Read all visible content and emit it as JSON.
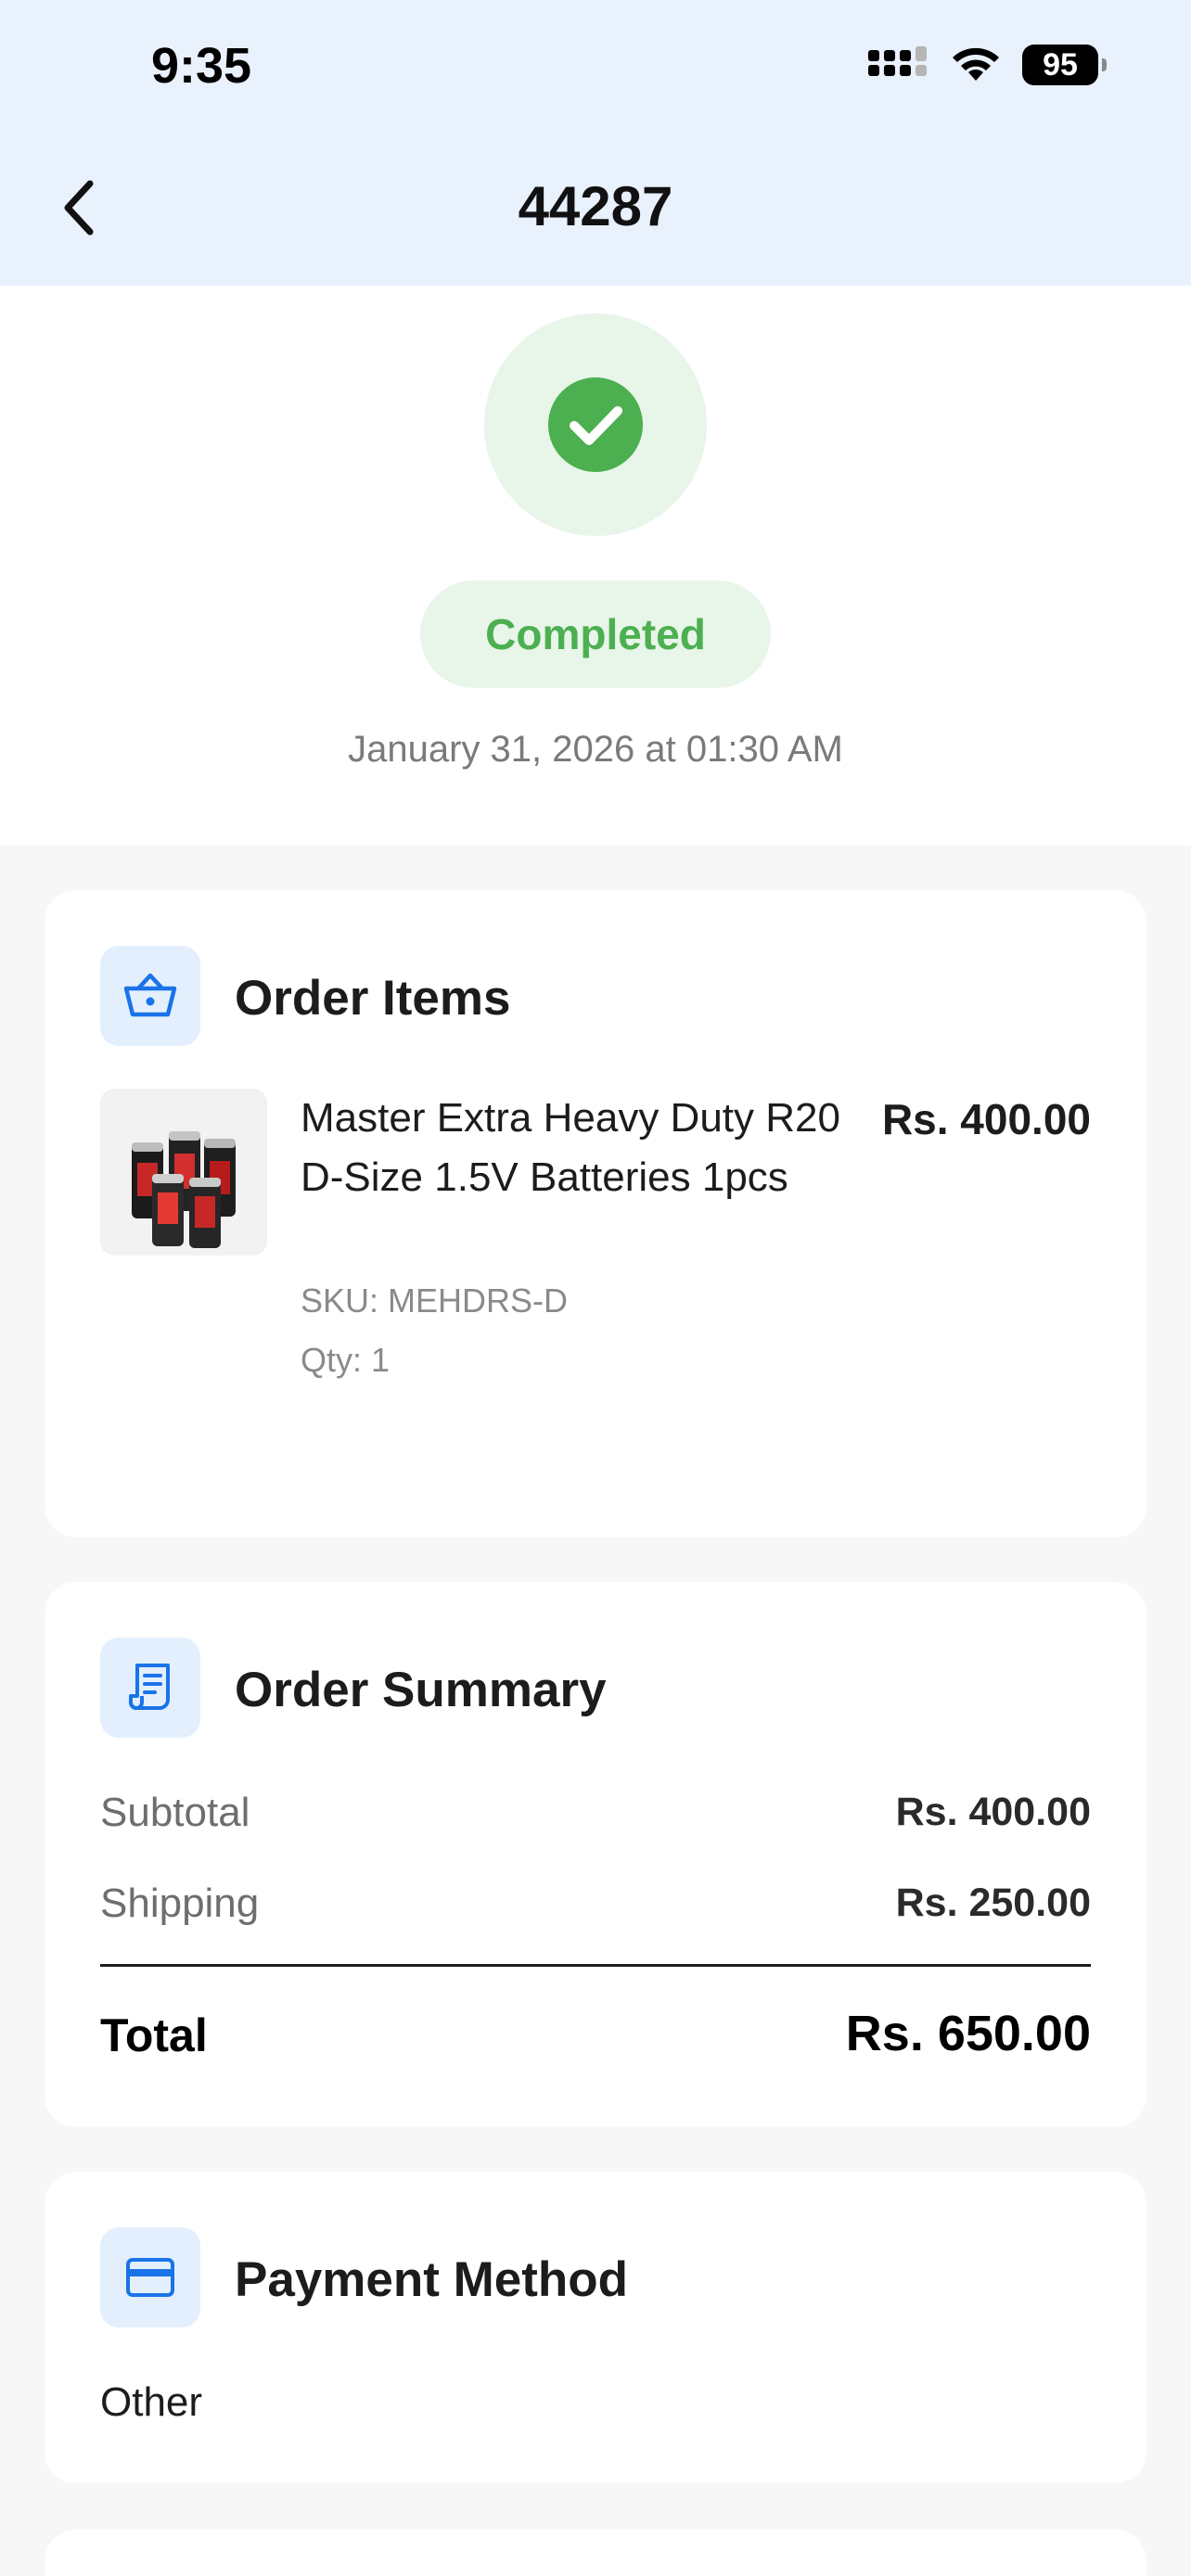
{
  "status_bar": {
    "time": "9:35",
    "battery": "95"
  },
  "header": {
    "title": "44287"
  },
  "order_status": {
    "label": "Completed",
    "date": "January 31, 2026 at 01:30 AM"
  },
  "order_items": {
    "title": "Order Items",
    "items": [
      {
        "name": "Master Extra Heavy Duty R20 D-Size 1.5V Batteries 1pcs",
        "price": "Rs. 400.00",
        "sku": "SKU: MEHDRS-D",
        "qty": "Qty: 1"
      }
    ]
  },
  "order_summary": {
    "title": "Order Summary",
    "subtotal_label": "Subtotal",
    "subtotal_value": "Rs. 400.00",
    "shipping_label": "Shipping",
    "shipping_value": "Rs. 250.00",
    "total_label": "Total",
    "total_value": "Rs. 650.00"
  },
  "payment_method": {
    "title": "Payment Method",
    "value": "Other"
  },
  "colors": {
    "accent": "#1a73e8",
    "success": "#4caf50",
    "header_bg": "#e8f1fc"
  },
  "icons": [
    "chevron-left-icon",
    "check-icon",
    "basket-icon",
    "receipt-icon",
    "credit-card-icon",
    "signal-icon",
    "wifi-icon",
    "battery-icon"
  ]
}
